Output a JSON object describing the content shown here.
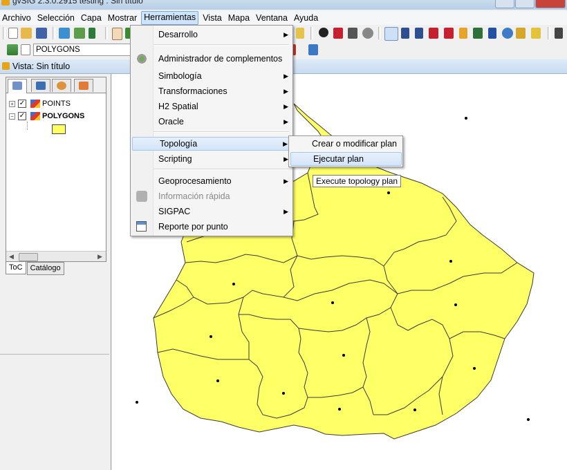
{
  "window": {
    "title": "gvSIG 2.3.0.2915 testing : Sin título"
  },
  "menubar": {
    "items": [
      {
        "id": "archivo",
        "label": "Archivo"
      },
      {
        "id": "seleccion",
        "label": "Selección"
      },
      {
        "id": "capa",
        "label": "Capa"
      },
      {
        "id": "mostrar",
        "label": "Mostrar"
      },
      {
        "id": "herramientas",
        "label": "Herramientas"
      },
      {
        "id": "vista",
        "label": "Vista"
      },
      {
        "id": "mapa",
        "label": "Mapa"
      },
      {
        "id": "ventana",
        "label": "Ventana"
      },
      {
        "id": "ayuda",
        "label": "Ayuda"
      }
    ],
    "active": "Herramientas"
  },
  "toolbar": {
    "layer_combo_value": "POLYGONS"
  },
  "view": {
    "title": "Vista: Sin título"
  },
  "toc": {
    "layers": [
      {
        "name": "POINTS",
        "checked": true,
        "bold": false
      },
      {
        "name": "POLYGONS",
        "checked": true,
        "bold": true
      }
    ],
    "legend_color": "#ffff66",
    "bottom_tabs": [
      "ToC",
      "Catálogo"
    ]
  },
  "herramientas_menu": {
    "items": [
      {
        "label": "Desarrollo",
        "submenu": true
      },
      {
        "label": "Administrador de complementos",
        "submenu": false,
        "icon": "plugin-gear-icon"
      },
      {
        "label": "Simbología",
        "submenu": true
      },
      {
        "label": "Transformaciones",
        "submenu": true
      },
      {
        "label": "H2 Spatial",
        "submenu": true
      },
      {
        "label": "Oracle",
        "submenu": true
      },
      {
        "label": "Topología",
        "submenu": true,
        "highlighted": true
      },
      {
        "label": "Scripting",
        "submenu": true
      },
      {
        "label": "Geoprocesamiento",
        "submenu": true
      },
      {
        "label": "Información rápida",
        "submenu": false,
        "disabled": true,
        "icon": "quick-info-icon"
      },
      {
        "label": "SIGPAC",
        "submenu": true
      },
      {
        "label": "Reporte por punto",
        "submenu": false,
        "icon": "point-report-icon"
      }
    ]
  },
  "topologia_submenu": {
    "items": [
      {
        "label": "Crear o modificar plan"
      },
      {
        "label": "Ejecutar plan",
        "highlighted": true
      }
    ]
  },
  "tooltip": {
    "text": "Execute topology plan"
  },
  "colors": {
    "polygon_fill": "#ffff66",
    "polygon_stroke": "#3a3a3a",
    "menu_highlight": "#d4e4f8",
    "selection_accent": "#7aa7dc"
  }
}
